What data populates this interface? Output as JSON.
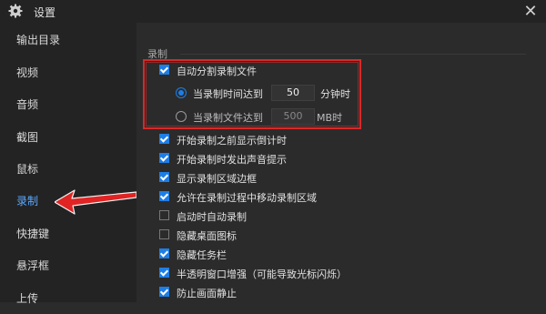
{
  "window": {
    "title": "设置",
    "close_glyph": "✕"
  },
  "sidebar": {
    "items": [
      {
        "label": "输出目录",
        "active": false
      },
      {
        "label": "视频",
        "active": false
      },
      {
        "label": "音频",
        "active": false
      },
      {
        "label": "截图",
        "active": false
      },
      {
        "label": "鼠标",
        "active": false
      },
      {
        "label": "录制",
        "active": true
      },
      {
        "label": "快捷键",
        "active": false
      },
      {
        "label": "悬浮框",
        "active": false
      },
      {
        "label": "上传",
        "active": false
      }
    ]
  },
  "main": {
    "section_title": "录制",
    "auto_split": {
      "label": "自动分割录制文件",
      "checked": true,
      "by_time": {
        "label": "当录制时间达到",
        "value": "50",
        "unit": "分钟时",
        "selected": true
      },
      "by_size": {
        "label": "当录制文件达到",
        "value": "500",
        "unit": "MB时",
        "selected": false
      }
    },
    "options": [
      {
        "label": "开始录制之前显示倒计时",
        "checked": true
      },
      {
        "label": "开始录制时发出声音提示",
        "checked": true
      },
      {
        "label": "显示录制区域边框",
        "checked": true
      },
      {
        "label": "允许在录制过程中移动录制区域",
        "checked": true
      },
      {
        "label": "启动时自动录制",
        "checked": false
      },
      {
        "label": "隐藏桌面图标",
        "checked": false
      },
      {
        "label": "隐藏任务栏",
        "checked": true
      },
      {
        "label": "半透明窗口增强（可能导致光标闪烁）",
        "checked": true
      },
      {
        "label": "防止画面静止",
        "checked": true
      }
    ]
  },
  "colors": {
    "accent": "#1e7ee6",
    "highlight": "#d42a2a",
    "active_nav": "#5aa9ff"
  },
  "icons": {
    "title": "gear-icon",
    "close": "close-icon"
  }
}
